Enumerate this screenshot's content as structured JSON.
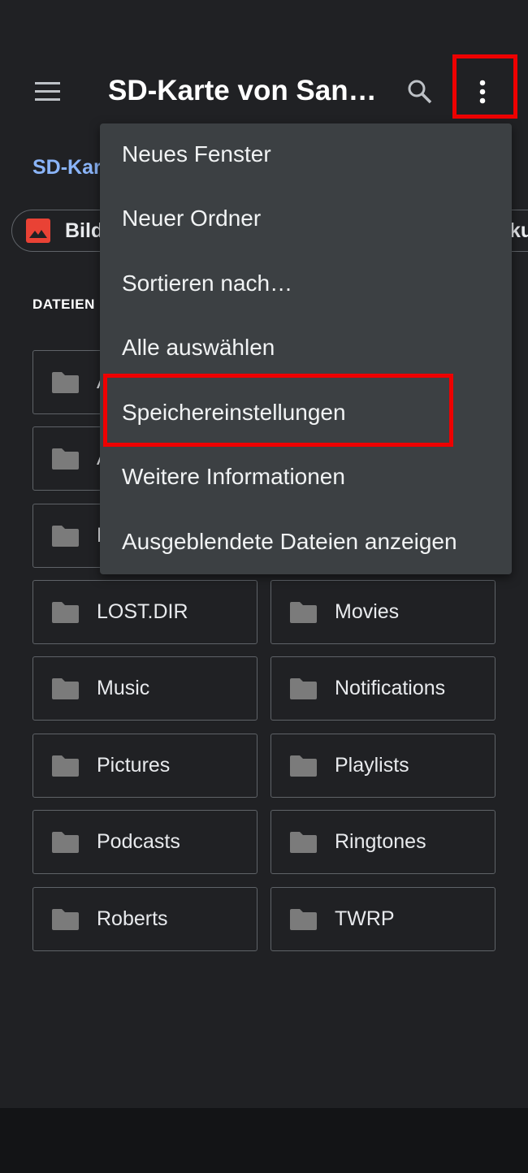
{
  "appbar": {
    "title": "SD-Karte von San…",
    "menu_icon": "hamburger-icon",
    "search_icon": "search-icon",
    "more_icon": "more-vert-icon"
  },
  "breadcrumb": "SD-Kar",
  "chips": [
    {
      "label": "Bild",
      "icon": "image-icon",
      "icon_color": "#e94235"
    },
    {
      "label": "ku"
    }
  ],
  "section_header": "DATEIEN",
  "folders": [
    "A",
    "A",
    "D",
    "LOST.DIR",
    "Movies",
    "Music",
    "Notifications",
    "Pictures",
    "Playlists",
    "Podcasts",
    "Ringtones",
    "Roberts",
    "TWRP"
  ],
  "menu": {
    "items": [
      "Neues Fenster",
      "Neuer Ordner",
      "Sortieren nach…",
      "Alle auswählen",
      "Speichereinstellungen",
      "Weitere Informationen",
      "Ausgeblendete Dateien anzeigen"
    ],
    "highlighted": "Speichereinstellungen"
  },
  "colors": {
    "background": "#202124",
    "menu": "#3c4043",
    "accent": "#8ab4f8",
    "highlight": "#ee0000"
  }
}
